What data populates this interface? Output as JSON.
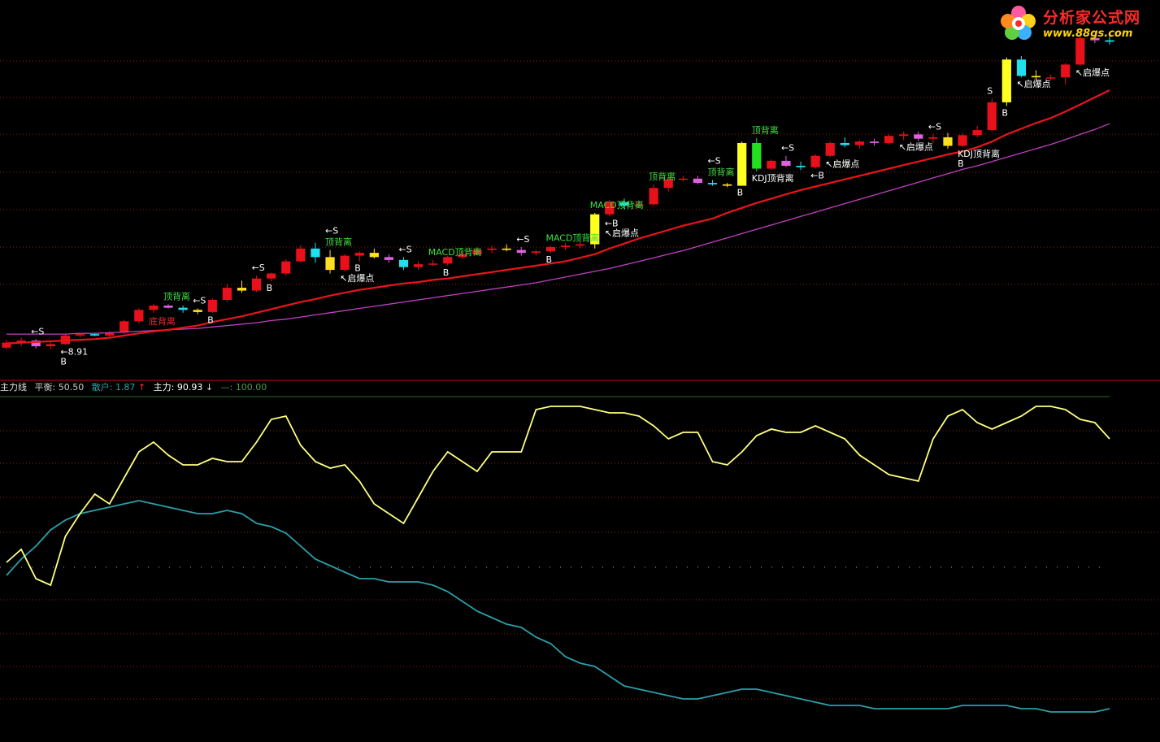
{
  "indicator": {
    "name": "主力线",
    "balance_label": "平衡:",
    "balance_value": "50.50",
    "retail_label": "散户:",
    "retail_value": "1.87",
    "retail_arrow": "↑",
    "main_label": "主力:",
    "main_value": "90.93",
    "main_arrow": "↓",
    "ref_label": "—:",
    "ref_value": "100.00"
  },
  "logo": {
    "title": "分析家公式网",
    "url": "www.88gs.com"
  },
  "colors": {
    "background": "#000000",
    "grid": "#8b1a1a",
    "up_candle": "#e8101a",
    "ma_fast": "#e8151a",
    "ma_slow": "#c040c0",
    "main_line": "#ffff80",
    "retail_line": "#2aa0a8",
    "signal_text": "#ffffff",
    "divergence_text": "#40e040",
    "bottom_divergence_text": "#e03030"
  },
  "chart_data": [
    {
      "type": "candlestick",
      "panel": "price",
      "candles": [
        [
          8.91,
          9.02,
          8.88,
          8.98
        ],
        [
          8.98,
          9.05,
          8.93,
          9.01
        ],
        [
          9.01,
          9.03,
          8.9,
          8.93
        ],
        [
          8.93,
          8.99,
          8.89,
          8.96
        ],
        [
          8.96,
          9.1,
          8.95,
          9.08
        ],
        [
          9.08,
          9.12,
          9.05,
          9.1
        ],
        [
          9.1,
          9.12,
          9.07,
          9.08
        ],
        [
          9.08,
          9.14,
          9.06,
          9.12
        ],
        [
          9.12,
          9.3,
          9.1,
          9.28
        ],
        [
          9.28,
          9.46,
          9.25,
          9.44
        ],
        [
          9.44,
          9.52,
          9.4,
          9.5
        ],
        [
          9.5,
          9.52,
          9.46,
          9.47
        ],
        [
          9.47,
          9.5,
          9.4,
          9.44
        ],
        [
          9.44,
          9.46,
          9.38,
          9.41
        ],
        [
          9.41,
          9.6,
          9.39,
          9.58
        ],
        [
          9.58,
          9.8,
          9.55,
          9.75
        ],
        [
          9.75,
          9.85,
          9.68,
          9.71
        ],
        [
          9.71,
          9.92,
          9.69,
          9.88
        ],
        [
          9.88,
          9.96,
          9.84,
          9.95
        ],
        [
          9.95,
          10.15,
          9.92,
          10.12
        ],
        [
          10.12,
          10.35,
          10.1,
          10.3
        ],
        [
          10.3,
          10.38,
          10.1,
          10.18
        ],
        [
          10.18,
          10.28,
          9.95,
          10.0
        ],
        [
          10.0,
          10.22,
          9.98,
          10.2
        ],
        [
          10.2,
          10.26,
          10.12,
          10.24
        ],
        [
          10.24,
          10.3,
          10.16,
          10.18
        ],
        [
          10.18,
          10.22,
          10.1,
          10.14
        ],
        [
          10.14,
          10.18,
          10.0,
          10.04
        ],
        [
          10.04,
          10.12,
          10.0,
          10.08
        ],
        [
          10.08,
          10.14,
          10.05,
          10.09
        ],
        [
          10.09,
          10.2,
          10.06,
          10.18
        ],
        [
          10.18,
          10.26,
          10.15,
          10.22
        ],
        [
          10.22,
          10.32,
          10.2,
          10.28
        ],
        [
          10.28,
          10.34,
          10.24,
          10.3
        ],
        [
          10.3,
          10.36,
          10.26,
          10.28
        ],
        [
          10.28,
          10.32,
          10.2,
          10.24
        ],
        [
          10.24,
          10.28,
          10.2,
          10.26
        ],
        [
          10.26,
          10.34,
          10.24,
          10.32
        ],
        [
          10.32,
          10.38,
          10.28,
          10.34
        ],
        [
          10.34,
          10.4,
          10.3,
          10.36
        ],
        [
          10.36,
          10.8,
          10.3,
          10.78
        ],
        [
          10.78,
          10.98,
          10.75,
          10.95
        ],
        [
          10.95,
          11.0,
          10.85,
          10.9
        ],
        [
          10.9,
          10.96,
          10.86,
          10.92
        ],
        [
          10.92,
          11.2,
          10.9,
          11.15
        ],
        [
          11.15,
          11.3,
          11.1,
          11.27
        ],
        [
          11.27,
          11.32,
          11.24,
          11.28
        ],
        [
          11.28,
          11.32,
          11.2,
          11.22
        ],
        [
          11.22,
          11.26,
          11.18,
          11.2
        ],
        [
          11.2,
          11.22,
          11.16,
          11.18
        ],
        [
          11.18,
          11.8,
          11.18,
          11.78
        ],
        [
          11.78,
          11.85,
          11.38,
          11.42
        ],
        [
          11.42,
          11.55,
          11.4,
          11.53
        ],
        [
          11.53,
          11.6,
          11.44,
          11.46
        ],
        [
          11.46,
          11.52,
          11.4,
          11.44
        ],
        [
          11.44,
          11.62,
          11.42,
          11.6
        ],
        [
          11.6,
          11.8,
          11.58,
          11.78
        ],
        [
          11.78,
          11.86,
          11.72,
          11.75
        ],
        [
          11.75,
          11.82,
          11.7,
          11.8
        ],
        [
          11.8,
          11.84,
          11.74,
          11.78
        ],
        [
          11.78,
          11.9,
          11.76,
          11.88
        ],
        [
          11.88,
          11.94,
          11.82,
          11.9
        ],
        [
          11.9,
          11.94,
          11.8,
          11.84
        ],
        [
          11.84,
          11.9,
          11.78,
          11.86
        ],
        [
          11.86,
          11.92,
          11.7,
          11.74
        ],
        [
          11.74,
          11.92,
          11.72,
          11.89
        ],
        [
          11.89,
          12.02,
          11.86,
          11.96
        ],
        [
          11.96,
          12.4,
          11.94,
          12.35
        ],
        [
          12.35,
          12.98,
          12.3,
          12.95
        ],
        [
          12.95,
          13.0,
          12.7,
          12.72
        ],
        [
          12.72,
          12.8,
          12.66,
          12.7
        ],
        [
          12.7,
          12.74,
          12.66,
          12.7
        ],
        [
          12.7,
          12.9,
          12.6,
          12.88
        ],
        [
          12.88,
          13.28,
          12.86,
          13.25
        ],
        [
          13.25,
          13.3,
          13.18,
          13.22
        ],
        [
          13.22,
          13.3,
          13.16,
          13.2
        ]
      ],
      "ma_fast": [
        8.97,
        8.98,
        8.99,
        9.0,
        9.01,
        9.02,
        9.03,
        9.05,
        9.08,
        9.11,
        9.14,
        9.16,
        9.19,
        9.22,
        9.27,
        9.31,
        9.35,
        9.4,
        9.45,
        9.5,
        9.55,
        9.59,
        9.64,
        9.68,
        9.72,
        9.75,
        9.78,
        9.81,
        9.83,
        9.86,
        9.88,
        9.91,
        9.94,
        9.97,
        10.0,
        10.03,
        10.06,
        10.09,
        10.12,
        10.17,
        10.22,
        10.3,
        10.37,
        10.44,
        10.5,
        10.56,
        10.62,
        10.67,
        10.72,
        10.8,
        10.87,
        10.94,
        11.0,
        11.06,
        11.12,
        11.17,
        11.22,
        11.27,
        11.32,
        11.37,
        11.42,
        11.47,
        11.52,
        11.57,
        11.62,
        11.66,
        11.72,
        11.8,
        11.9,
        11.98,
        12.06,
        12.13,
        12.22,
        12.32,
        12.42,
        12.52
      ],
      "ma_slow": [
        9.1,
        9.1,
        9.1,
        9.1,
        9.1,
        9.11,
        9.11,
        9.12,
        9.13,
        9.14,
        9.15,
        9.16,
        9.17,
        9.18,
        9.2,
        9.22,
        9.24,
        9.26,
        9.29,
        9.31,
        9.34,
        9.37,
        9.4,
        9.43,
        9.46,
        9.49,
        9.52,
        9.55,
        9.58,
        9.61,
        9.64,
        9.67,
        9.7,
        9.73,
        9.76,
        9.79,
        9.82,
        9.86,
        9.9,
        9.94,
        9.98,
        10.02,
        10.07,
        10.12,
        10.17,
        10.22,
        10.27,
        10.33,
        10.39,
        10.45,
        10.51,
        10.57,
        10.63,
        10.69,
        10.75,
        10.81,
        10.87,
        10.93,
        10.99,
        11.05,
        11.11,
        11.17,
        11.23,
        11.29,
        11.35,
        11.41,
        11.46,
        11.52,
        11.58,
        11.64,
        11.7,
        11.76,
        11.83,
        11.9,
        11.97,
        12.05
      ],
      "annotations": [
        {
          "i": 2,
          "text": "←S",
          "kind": "signal"
        },
        {
          "i": 4,
          "text": "←8.91",
          "kind": "signal"
        },
        {
          "i": 4,
          "text": "B",
          "kind": "signal"
        },
        {
          "i": 10,
          "text": "底背离",
          "kind": "bottom"
        },
        {
          "i": 11,
          "text": "顶背离",
          "kind": "div"
        },
        {
          "i": 13,
          "text": "←S",
          "kind": "signal"
        },
        {
          "i": 14,
          "text": "B",
          "kind": "signal"
        },
        {
          "i": 17,
          "text": "←S",
          "kind": "signal"
        },
        {
          "i": 18,
          "text": "B",
          "kind": "signal"
        },
        {
          "i": 22,
          "text": "顶背离",
          "kind": "div"
        },
        {
          "i": 22,
          "text": "←S",
          "kind": "signal"
        },
        {
          "i": 23,
          "text": "↖启爆点",
          "kind": "signal"
        },
        {
          "i": 24,
          "text": "B",
          "kind": "signal"
        },
        {
          "i": 27,
          "text": "←S",
          "kind": "signal"
        },
        {
          "i": 29,
          "text": "MACD顶背离",
          "kind": "div"
        },
        {
          "i": 30,
          "text": "B",
          "kind": "signal"
        },
        {
          "i": 35,
          "text": "←S",
          "kind": "signal"
        },
        {
          "i": 37,
          "text": "MACD顶背离",
          "kind": "div"
        },
        {
          "i": 37,
          "text": "B",
          "kind": "signal"
        },
        {
          "i": 40,
          "text": "MACD顶背离",
          "kind": "div"
        },
        {
          "i": 41,
          "text": "←B",
          "kind": "signal"
        },
        {
          "i": 41,
          "text": "↖启爆点",
          "kind": "signal"
        },
        {
          "i": 44,
          "text": "顶背离",
          "kind": "div"
        },
        {
          "i": 48,
          "text": "顶背离",
          "kind": "div"
        },
        {
          "i": 48,
          "text": "←S",
          "kind": "signal"
        },
        {
          "i": 50,
          "text": "B",
          "kind": "signal"
        },
        {
          "i": 51,
          "text": "顶背离",
          "kind": "div"
        },
        {
          "i": 51,
          "text": "KDJ顶背离",
          "kind": "signal"
        },
        {
          "i": 53,
          "text": "←S",
          "kind": "signal"
        },
        {
          "i": 55,
          "text": "←B",
          "kind": "signal"
        },
        {
          "i": 56,
          "text": "↖启爆点",
          "kind": "signal"
        },
        {
          "i": 61,
          "text": "↖启爆点",
          "kind": "signal"
        },
        {
          "i": 63,
          "text": "←S",
          "kind": "signal"
        },
        {
          "i": 65,
          "text": "KDJ顶背离",
          "kind": "signal"
        },
        {
          "i": 65,
          "text": "B",
          "kind": "signal"
        },
        {
          "i": 67,
          "text": "S",
          "kind": "signal"
        },
        {
          "i": 68,
          "text": "B",
          "kind": "signal"
        },
        {
          "i": 69,
          "text": "↖启爆点",
          "kind": "signal"
        },
        {
          "i": 73,
          "text": "↖启爆点",
          "kind": "signal"
        }
      ]
    },
    {
      "type": "line",
      "panel": "indicator",
      "ylim": [
        0,
        100
      ],
      "series": [
        {
          "name": "主力",
          "values": [
            52,
            56,
            47,
            45,
            60,
            67,
            73,
            70,
            78,
            86,
            89,
            85,
            82,
            82,
            84,
            83,
            83,
            89,
            96,
            97,
            88,
            83,
            81,
            82,
            77,
            70,
            67,
            64,
            72,
            80,
            86,
            83,
            80,
            86,
            86,
            86,
            99,
            100,
            100,
            100,
            99,
            98,
            98,
            97,
            94,
            90,
            92,
            92,
            83,
            82,
            86,
            91,
            93,
            92,
            92,
            94,
            92,
            90,
            85,
            82,
            79,
            78,
            77,
            90,
            97,
            99,
            95,
            93,
            95,
            97,
            100,
            100,
            99,
            96,
            95,
            90
          ]
        },
        {
          "name": "散户",
          "values": [
            48,
            53,
            57,
            62,
            65,
            67,
            68,
            69,
            70,
            71,
            70,
            69,
            68,
            67,
            67,
            68,
            67,
            64,
            63,
            61,
            57,
            53,
            51,
            49,
            47,
            47,
            46,
            46,
            46,
            45,
            43,
            40,
            37,
            35,
            33,
            32,
            29,
            27,
            23,
            21,
            20,
            17,
            14,
            13,
            12,
            11,
            10,
            10,
            11,
            12,
            13,
            13,
            12,
            11,
            10,
            9,
            8,
            8,
            8,
            7,
            7,
            7,
            7,
            7,
            7,
            8,
            8,
            8,
            8,
            7,
            7,
            6,
            6,
            6,
            6,
            7
          ]
        }
      ]
    }
  ]
}
